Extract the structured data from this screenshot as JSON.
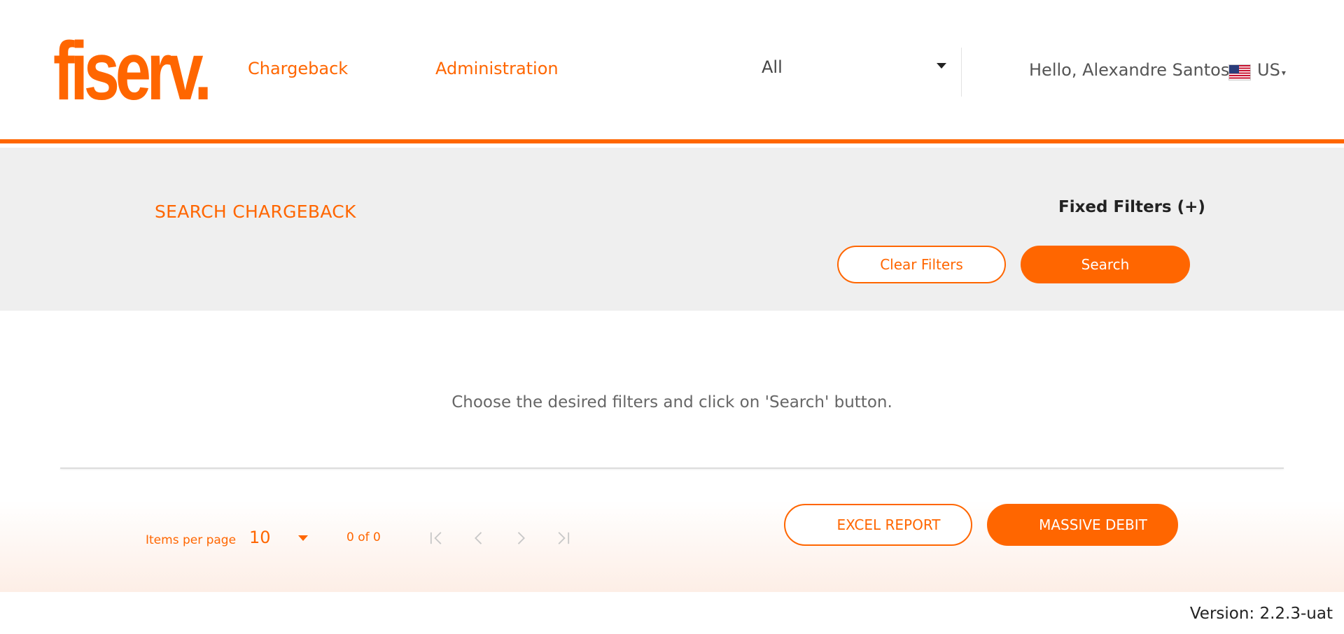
{
  "header": {
    "logo_text": "fiserv.",
    "nav": {
      "chargeback": "Chargeback",
      "administration": "Administration"
    },
    "selector_value": "All",
    "greeting": "Hello, Alexandre Santos",
    "language": "US"
  },
  "search": {
    "title": "SEARCH CHARGEBACK",
    "fixed_filters_label": "Fixed Filters (+)",
    "clear_filters_label": "Clear Filters",
    "search_label": "Search"
  },
  "results": {
    "empty_message": "Choose the desired filters and click on 'Search' button."
  },
  "pagination": {
    "items_per_page_label": "Items per page",
    "items_per_page_value": "10",
    "range_label": "0 of 0"
  },
  "actions": {
    "excel_report_label": "EXCEL REPORT",
    "massive_debit_label": "MASSIVE DEBIT"
  },
  "footer": {
    "version": "Version: 2.2.3-uat"
  },
  "colors": {
    "brand": "#ff6600",
    "band": "#efefef",
    "muted_icon": "#c8c8c8"
  },
  "icons": {
    "language_flag": "us-flag-icon",
    "first_page": "first-page-icon",
    "previous_page": "previous-page-icon",
    "next_page": "next-page-icon",
    "last_page": "last-page-icon"
  }
}
